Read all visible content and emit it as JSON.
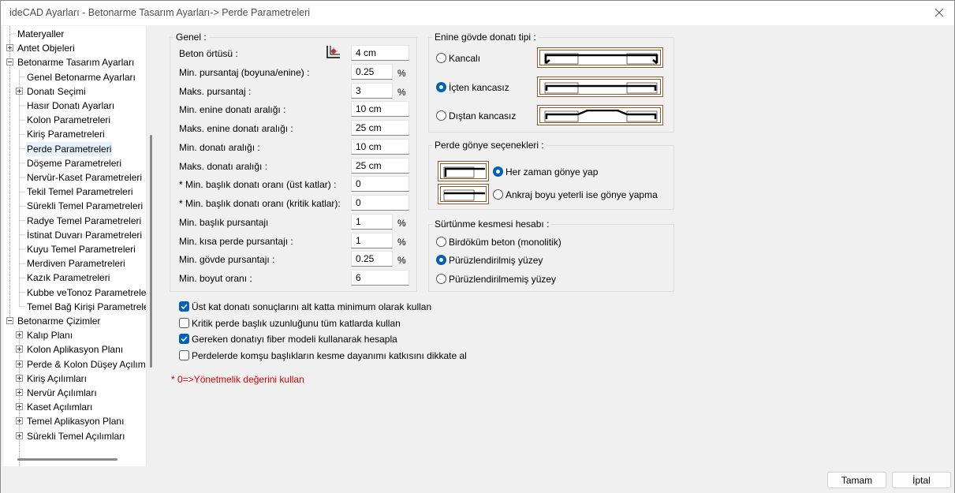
{
  "window": {
    "title": "ideCAD Ayarları - Betonarme Tasarım Ayarları-> Perde Parametreleri"
  },
  "tree": {
    "items": [
      {
        "label": "Materyaller",
        "level": 0,
        "expander": "none"
      },
      {
        "label": "Antet Objeleri",
        "level": 0,
        "expander": "plus"
      },
      {
        "label": "Betonarme Tasarım Ayarları",
        "level": 0,
        "expander": "minus"
      },
      {
        "label": "Genel Betonarme Ayarları",
        "level": 1,
        "expander": "none"
      },
      {
        "label": "Donatı Seçimi",
        "level": 1,
        "expander": "plus"
      },
      {
        "label": "Hasır Donatı Ayarları",
        "level": 1,
        "expander": "none"
      },
      {
        "label": "Kolon Parametreleri",
        "level": 1,
        "expander": "none"
      },
      {
        "label": "Kiriş Parametreleri",
        "level": 1,
        "expander": "none"
      },
      {
        "label": "Perde Parametreleri",
        "level": 1,
        "expander": "none",
        "selected": true
      },
      {
        "label": "Döşeme Parametreleri",
        "level": 1,
        "expander": "none"
      },
      {
        "label": "Nervür-Kaset Parametreleri",
        "level": 1,
        "expander": "none"
      },
      {
        "label": "Tekil Temel Parametreleri",
        "level": 1,
        "expander": "none"
      },
      {
        "label": "Sürekli Temel Parametreleri",
        "level": 1,
        "expander": "none"
      },
      {
        "label": "Radye Temel Parametreleri",
        "level": 1,
        "expander": "none"
      },
      {
        "label": "İstinat Duvarı Parametreleri",
        "level": 1,
        "expander": "none"
      },
      {
        "label": "Kuyu Temel Parametreleri",
        "level": 1,
        "expander": "none"
      },
      {
        "label": "Merdiven Parametreleri",
        "level": 1,
        "expander": "none"
      },
      {
        "label": "Kazık Parametreleri",
        "level": 1,
        "expander": "none"
      },
      {
        "label": "Kubbe veTonoz Parametreler",
        "level": 1,
        "expander": "none"
      },
      {
        "label": "Temel Bağ Kirişi Parametreler",
        "level": 1,
        "expander": "none"
      },
      {
        "label": "Betonarme Çizimler",
        "level": 0,
        "expander": "minus"
      },
      {
        "label": "Kalıp Planı",
        "level": 1,
        "expander": "plus"
      },
      {
        "label": "Kolon Aplikasyon Planı",
        "level": 1,
        "expander": "plus"
      },
      {
        "label": "Perde & Kolon Düşey Açılıml",
        "level": 1,
        "expander": "plus"
      },
      {
        "label": "Kiriş Açılımları",
        "level": 1,
        "expander": "plus"
      },
      {
        "label": "Nervür Açılımları",
        "level": 1,
        "expander": "plus"
      },
      {
        "label": "Kaset Açılımları",
        "level": 1,
        "expander": "plus"
      },
      {
        "label": "Temel Aplikasyon Planı",
        "level": 1,
        "expander": "plus"
      },
      {
        "label": "Sürekli Temel Açılımları",
        "level": 1,
        "expander": "plus"
      }
    ]
  },
  "genel": {
    "title": "Genel :",
    "fields": [
      {
        "label": "Beton örtüsü :",
        "value": "4 cm",
        "unit": "",
        "icon": true
      },
      {
        "label": "Min. pursantaj (boyuna/enine) :",
        "value": "0.25",
        "unit": "%"
      },
      {
        "label": "Maks. pursantaj :",
        "value": "3",
        "unit": "%"
      },
      {
        "label": "Min. enine donatı aralığı :",
        "value": "10 cm",
        "unit": ""
      },
      {
        "label": "Maks. enine donatı aralığı :",
        "value": "25 cm",
        "unit": ""
      },
      {
        "label": "Min. donatı aralığı :",
        "value": "10 cm",
        "unit": ""
      },
      {
        "label": "Maks. donatı aralığı :",
        "value": "25 cm",
        "unit": ""
      },
      {
        "label": "* Min. başlık donatı oranı (üst katlar) :",
        "value": "0",
        "unit": ""
      },
      {
        "label": "* Min. başlık donatı oranı (kritik katlar):",
        "value": "0",
        "unit": ""
      },
      {
        "label": "Min. başlık pursantajı",
        "value": "1",
        "unit": "%"
      },
      {
        "label": "Min. kısa perde pursantajı :",
        "value": "1",
        "unit": "%"
      },
      {
        "label": "Min. gövde pursantajı :",
        "value": "0.25",
        "unit": "%"
      },
      {
        "label": "Min. boyut oranı :",
        "value": "6",
        "unit": ""
      }
    ]
  },
  "enine": {
    "title": "Enine gövde donatı tipi :",
    "options": [
      {
        "label": "Kancalı",
        "checked": false
      },
      {
        "label": "İçten kancasız",
        "checked": true
      },
      {
        "label": "Dıştan kancasız",
        "checked": false
      }
    ]
  },
  "gonye": {
    "title": "Perde gönye seçenekleri :",
    "options": [
      {
        "label": "Her zaman gönye yap",
        "checked": true
      },
      {
        "label": "Ankraj boyu yeterli ise gönye yapma",
        "checked": false
      }
    ]
  },
  "surtunme": {
    "title": "Sürtünme kesmesi hesabı :",
    "options": [
      {
        "label": "Birdöküm beton (monolitik)",
        "checked": false
      },
      {
        "label": "Pürüzlendirilmiş yüzey",
        "checked": true
      },
      {
        "label": "Pürüzlendirilmemiş yüzey",
        "checked": false
      }
    ]
  },
  "checkboxes": [
    {
      "label": "Üst kat donatı sonuçlarını alt katta minimum olarak kullan",
      "checked": true
    },
    {
      "label": "Kritik perde başlık uzunluğunu tüm katlarda kullan",
      "checked": false
    },
    {
      "label": "Gereken donatıyı fiber modeli kullanarak hesapla",
      "checked": true
    },
    {
      "label": "Perdelerde komşu başlıkların kesme dayanımı katkısını dikkate al",
      "checked": false
    }
  ],
  "note": "* 0=>Yönetmelik değerini kullan",
  "buttons": {
    "ok": "Tamam",
    "cancel": "İptal"
  },
  "colors": {
    "accent": "#005fb8",
    "note": "#e00000",
    "rebar_frame": "#8b5a2b"
  }
}
